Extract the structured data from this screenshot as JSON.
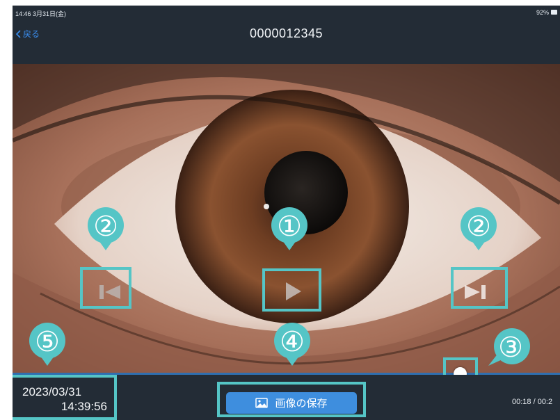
{
  "status_bar": {
    "time_date": "14:46  3月31日(金)",
    "battery": "92%"
  },
  "nav": {
    "back_label": "戻る",
    "title": "0000012345"
  },
  "controls": {
    "play_icon": "play-icon",
    "prev_icon": "skip-previous-icon",
    "next_icon": "skip-next-icon"
  },
  "playback": {
    "progress": 0.82,
    "timecode": "00:18 / 00:2"
  },
  "capture": {
    "date": "2023/03/31",
    "time": "14:39:56"
  },
  "save_button": {
    "label": "画像の保存",
    "icon": "image-icon"
  },
  "callouts": [
    "①",
    "②",
    "②",
    "③",
    "④",
    "⑤"
  ],
  "colors": {
    "accent": "#3e8ede",
    "highlight": "#55c5c6",
    "background": "#232c36"
  }
}
